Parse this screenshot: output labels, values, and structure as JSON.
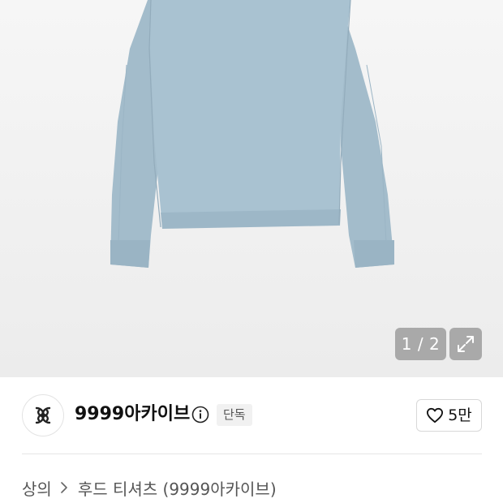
{
  "gallery": {
    "counter": "1 / 2",
    "product_color": "#a9c2d1"
  },
  "brand": {
    "name": "9999아카이브",
    "badge": "단독",
    "likes": "5만"
  },
  "breadcrumb": {
    "category": "상의",
    "product": "후드 티셔츠 (9999아카이브)"
  },
  "icons": {
    "counter": "image-counter",
    "expand": "expand-icon",
    "info": "info-icon",
    "like": "heart-icon",
    "separator": "chevron-right-icon"
  }
}
